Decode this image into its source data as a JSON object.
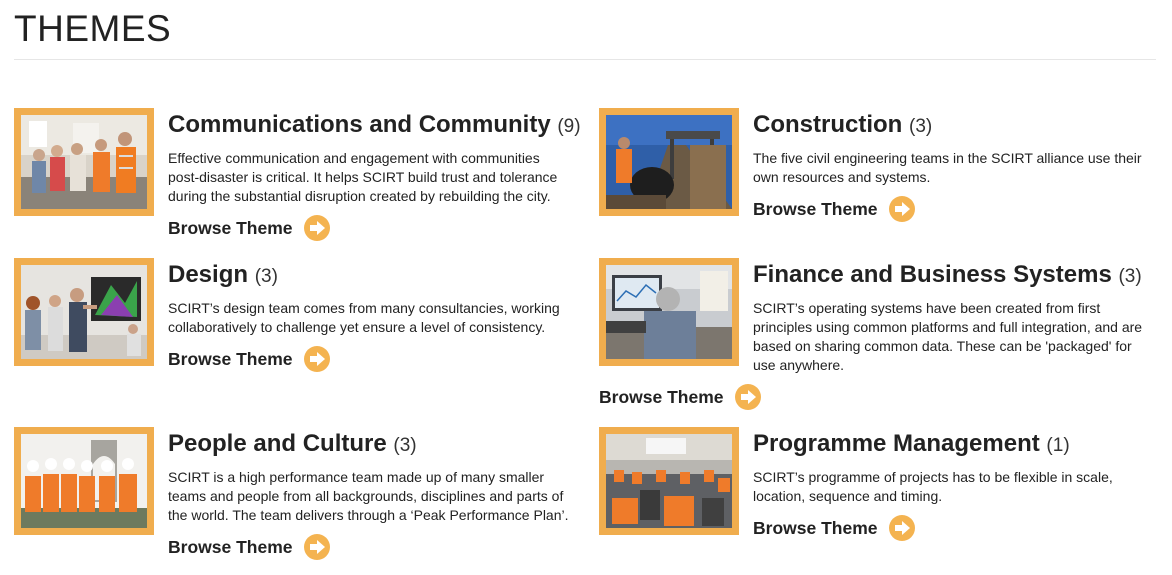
{
  "page": {
    "title": "THEMES"
  },
  "themes": [
    {
      "title": "Communications and Community",
      "count": "(9)",
      "description": "Effective communication and engagement with communities post-disaster is critical. It helps SCIRT build trust and tolerance during the substantial disruption created by rebuilding the city.",
      "browse_label": "Browse Theme",
      "image": "photo-people-meeting"
    },
    {
      "title": "Construction",
      "count": "(3)",
      "description": "The five civil engineering teams in the SCIRT alliance use their own resources and systems.",
      "browse_label": "Browse Theme",
      "image": "photo-pipe-construction"
    },
    {
      "title": "Design",
      "count": "(3)",
      "description": "SCIRT’s design team comes from many consultancies, working collaboratively to challenge yet ensure a level of consistency.",
      "browse_label": "Browse Theme",
      "image": "photo-design-screen"
    },
    {
      "title": "Finance and Business Systems",
      "count": "(3)",
      "description": "SCIRT’s operating systems have been created from first principles using common platforms and full integration, and are based on sharing common data. These can be 'packaged' for use anywhere.",
      "browse_label": "Browse Theme",
      "image": "photo-office-computer"
    },
    {
      "title": "People and Culture",
      "count": "(3)",
      "description": "SCIRT is a high performance team made up of many smaller teams and people from all backgrounds, disciplines and parts of the world. The team delivers through a ‘Peak Performance Plan’.",
      "browse_label": "Browse Theme",
      "image": "photo-team-hi-vis"
    },
    {
      "title": "Programme Management",
      "count": "(1)",
      "description": "SCIRT’s programme of projects has to be flexible in scale, location, sequence and timing.",
      "browse_label": "Browse Theme",
      "image": "photo-briefing-room"
    }
  ],
  "colors": {
    "accent": "#f0ad4e",
    "arrow": "#f4b350",
    "text": "#222222"
  },
  "icons": {
    "browse": "arrow-right-circle-icon"
  }
}
